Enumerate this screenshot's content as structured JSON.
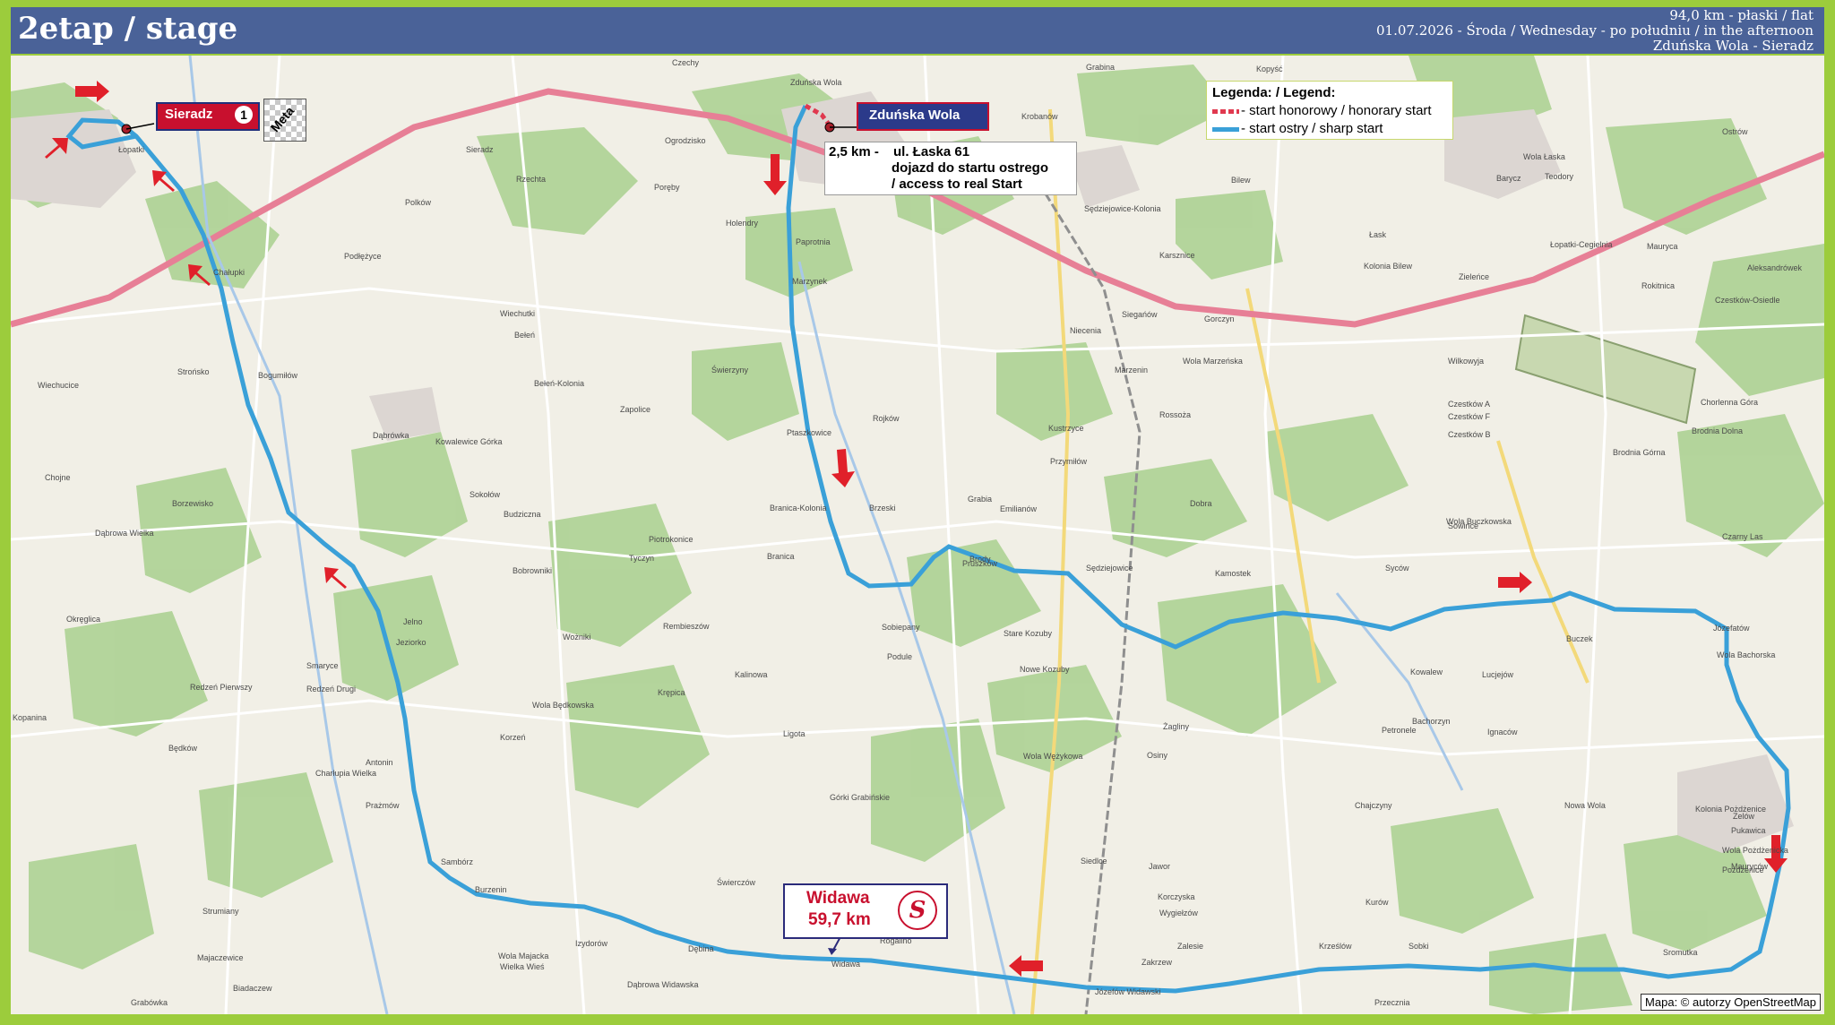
{
  "header": {
    "stage_title": "2etap / stage",
    "distance_line": "94,0 km - płaski / flat",
    "date_line": "01.07.2026 - Środa / Wednesday - po południu / in the afternoon",
    "route_line": "Zduńska Wola - Sieradz"
  },
  "legend": {
    "title": "Legenda: / Legend:",
    "honorary": "- start honorowy / honorary start",
    "sharp": "- start ostry / sharp start",
    "honorary_color": "#e0394f",
    "sharp_color": "#3aa0d8"
  },
  "labels": {
    "start_town": "Zduńska Wola",
    "finish_town": "Sieradz",
    "finish_number": "1",
    "finish_flag": "Meta",
    "access_distance": "2,5 km -",
    "access_street": "ul. Łaska 61",
    "access_pl": "dojazd do startu ostrego",
    "access_en": "/ access to real Start",
    "sprint_town": "Widawa",
    "sprint_km": "59,7 km",
    "sprint_symbol": "S"
  },
  "attribution": "Mapa: © autorzy OpenStreetMap",
  "places": [
    "Czechy",
    "Zduńska Wola",
    "Kopyść",
    "Grabina",
    "Krobanów",
    "Ogrodzisko",
    "Poręby",
    "Holendry",
    "Paprotnia",
    "Marzynek",
    "Świerzyny",
    "Zapolice",
    "Ptaszkowice",
    "Rojków",
    "Brzeski",
    "Branica-Kolonia",
    "Branica",
    "Rembieszów",
    "Sobiepany",
    "Podule",
    "Kalinowa",
    "Ligota",
    "Górki Grabińskie",
    "Świerczów",
    "Widawa",
    "Dębina",
    "Izydorów",
    "Rogalino",
    "Siedlce",
    "Jawor",
    "Korczyska",
    "Wygiełzów",
    "Zalesie",
    "Krześlów",
    "Sobki",
    "Sromutka",
    "Zelów",
    "Mauryców",
    "Pukawica",
    "Kolonia Pożdżenice",
    "Nowa Wola",
    "Chajczyny",
    "Kurów",
    "Petronele",
    "Żagliny",
    "Osiny",
    "Wola Wężykowa",
    "Nowe Kozuby",
    "Stare Kozuby",
    "Kamostek",
    "Sędziejowice",
    "Brody",
    "Emilianów",
    "Grabia",
    "Przymiłów",
    "Kustrzyce",
    "Dobra",
    "Wola Buczkowska",
    "Buczek",
    "Kowalew",
    "Lucjejów",
    "Bachorzyn",
    "Ignaców",
    "Józefatów",
    "Wola Bachorska",
    "Czarny Las",
    "Sowińce",
    "Chorlenna Góra",
    "Brodnia Dolna",
    "Brodnia Górna",
    "Wilkowyja",
    "Czestków A",
    "Czestków B",
    "Czestków F",
    "Czestków-Osiedle",
    "Aleksandrówek",
    "Rokitnica",
    "Mauryca",
    "Teodory",
    "Ostrów",
    "Barycz",
    "Wola Łaska",
    "Łask",
    "Łopatki-Cegielnia",
    "Zieleńce",
    "Gorczyn",
    "Siegańów",
    "Niecenia",
    "Marzenin",
    "Wola Marzeńska",
    "Rossoża",
    "Pruszków",
    "Sędziejowice-Kolonia",
    "Karsznice",
    "Bilew",
    "Kolonia Bilew",
    "Łopatki",
    "Sieradz",
    "Rzechta",
    "Polków",
    "Podłężyce",
    "Chałupki",
    "Wiechutki",
    "Bełeń",
    "Bełeń-Kolonia",
    "Strońsko",
    "Bogumiłów",
    "Wiechucice",
    "Dąbrówka",
    "Kowalewice Górka",
    "Chojne",
    "Borzewisko",
    "Dąbrowa Wielka",
    "Okręglica",
    "Sokołów",
    "Budziczna",
    "Bobrowniki",
    "Tyczyn",
    "Wożniki",
    "Piotrokonice",
    "Jelno",
    "Jeziorko",
    "Smaryce",
    "Redzeń Drugi",
    "Redzeń Pierwszy",
    "Krępica",
    "Wola Będkowska",
    "Korzeń",
    "Antonin",
    "Kopanina",
    "Charłupia Wielka",
    "Prażmów",
    "Sambórz",
    "Burzenin",
    "Strumiany",
    "Wola Majacka",
    "Wielka Wieś",
    "Majaczewice",
    "Biadaczew",
    "Grabówka",
    "Dąbrowa Widawska",
    "Józefów Widawski",
    "Przecznia",
    "Wola Pożdżenicka",
    "Pożdżenice",
    "Będków",
    "Zakrzew",
    "Syców"
  ]
}
